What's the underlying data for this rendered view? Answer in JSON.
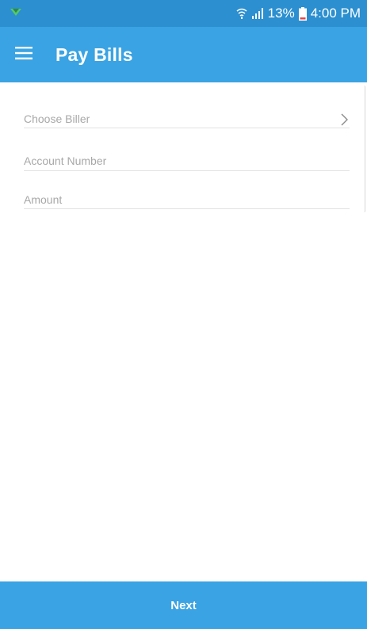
{
  "status_bar": {
    "battery": "13%",
    "time": "4:00 PM",
    "icons": [
      "notification-icon",
      "wifi-icon",
      "signal-icon",
      "battery-icon"
    ]
  },
  "app_bar": {
    "title": "Pay Bills",
    "menu_icon": "hamburger-menu-icon"
  },
  "form": {
    "biller_placeholder": "Choose Biller",
    "account_placeholder": "Account Number",
    "amount_placeholder": "Amount"
  },
  "footer": {
    "next_label": "Next"
  },
  "colors": {
    "status_bar": "#2b8fd0",
    "primary": "#3aa3e3",
    "placeholder": "#a8a8a8",
    "divider": "#e2e2e2"
  }
}
